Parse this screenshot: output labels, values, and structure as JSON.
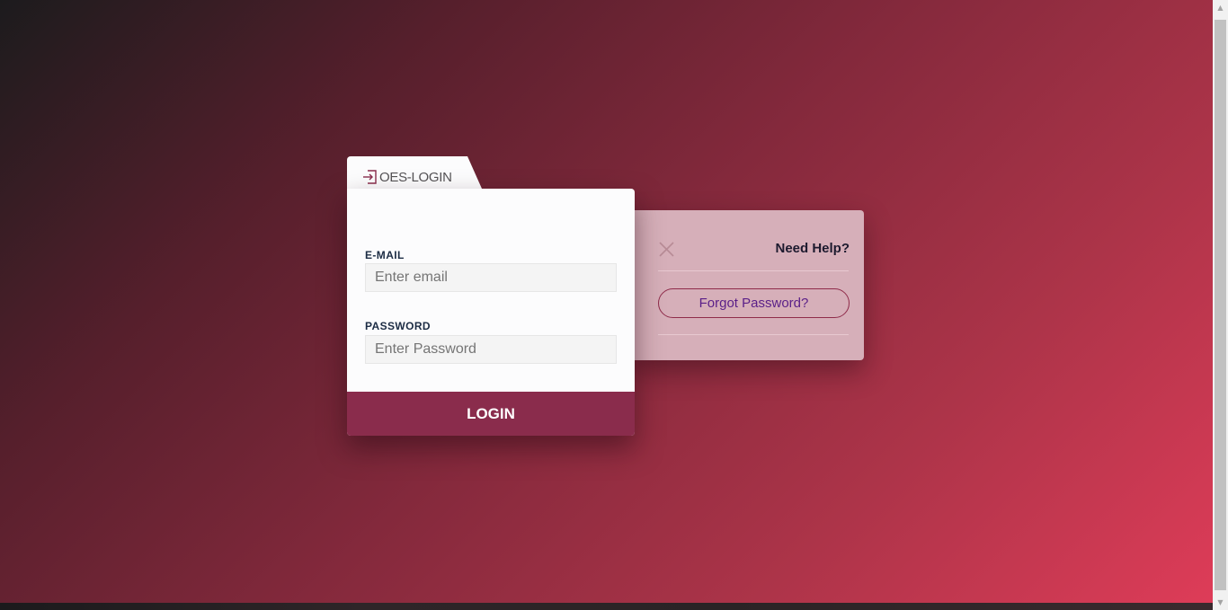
{
  "colors": {
    "accent": "#8a2c4c",
    "help_panel": "#d6afb9",
    "forgot_text": "#5a1f88"
  },
  "login": {
    "tab_icon": "login-enter-icon",
    "title": "OES-LOGIN",
    "email": {
      "label": "E-MAIL",
      "placeholder": "Enter email",
      "value": ""
    },
    "password": {
      "label": "PASSWORD",
      "placeholder": "Enter Password",
      "value": ""
    },
    "submit_label": "LOGIN"
  },
  "help": {
    "close_icon": "close-icon",
    "title": "Need Help?",
    "forgot_label": "Forgot Password?"
  }
}
